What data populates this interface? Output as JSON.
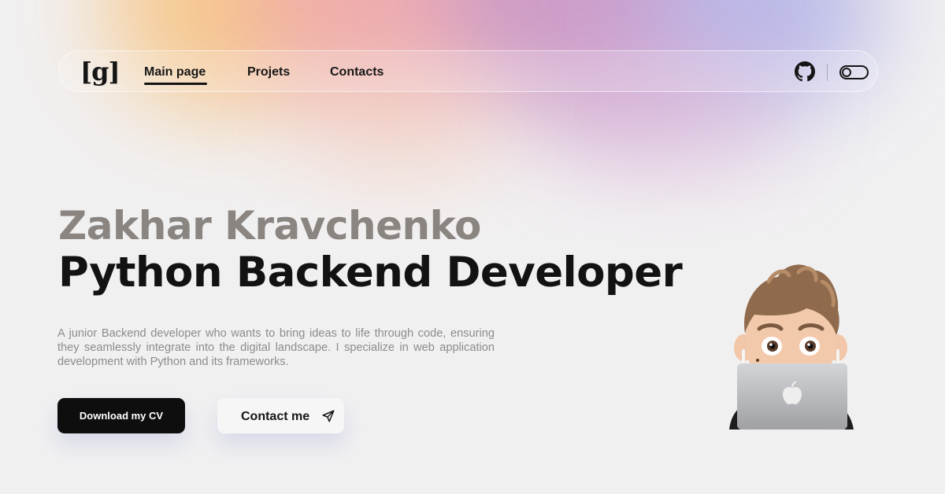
{
  "nav": {
    "logo": "[g]",
    "links": [
      "Main page",
      "Projets",
      "Contacts"
    ],
    "active": "Main page"
  },
  "hero": {
    "name": "Zakhar Kravchenko",
    "role": "Python Backend Developer",
    "description": "A junior Backend developer who wants to bring ideas to life through code, ensuring they seamlessly integrate into the digital landscape. I specialize in web application development with Python and its frameworks.",
    "cv_button": "Download my CV",
    "contact_button": "Contact me"
  },
  "icons": {
    "github": "github-icon",
    "theme": "theme-toggle-icon",
    "send": "send-icon",
    "avatar": "memoji-avatar"
  },
  "colors": {
    "name": "#8a8580",
    "role": "#121212",
    "button_dark": "#0e0e0e"
  }
}
